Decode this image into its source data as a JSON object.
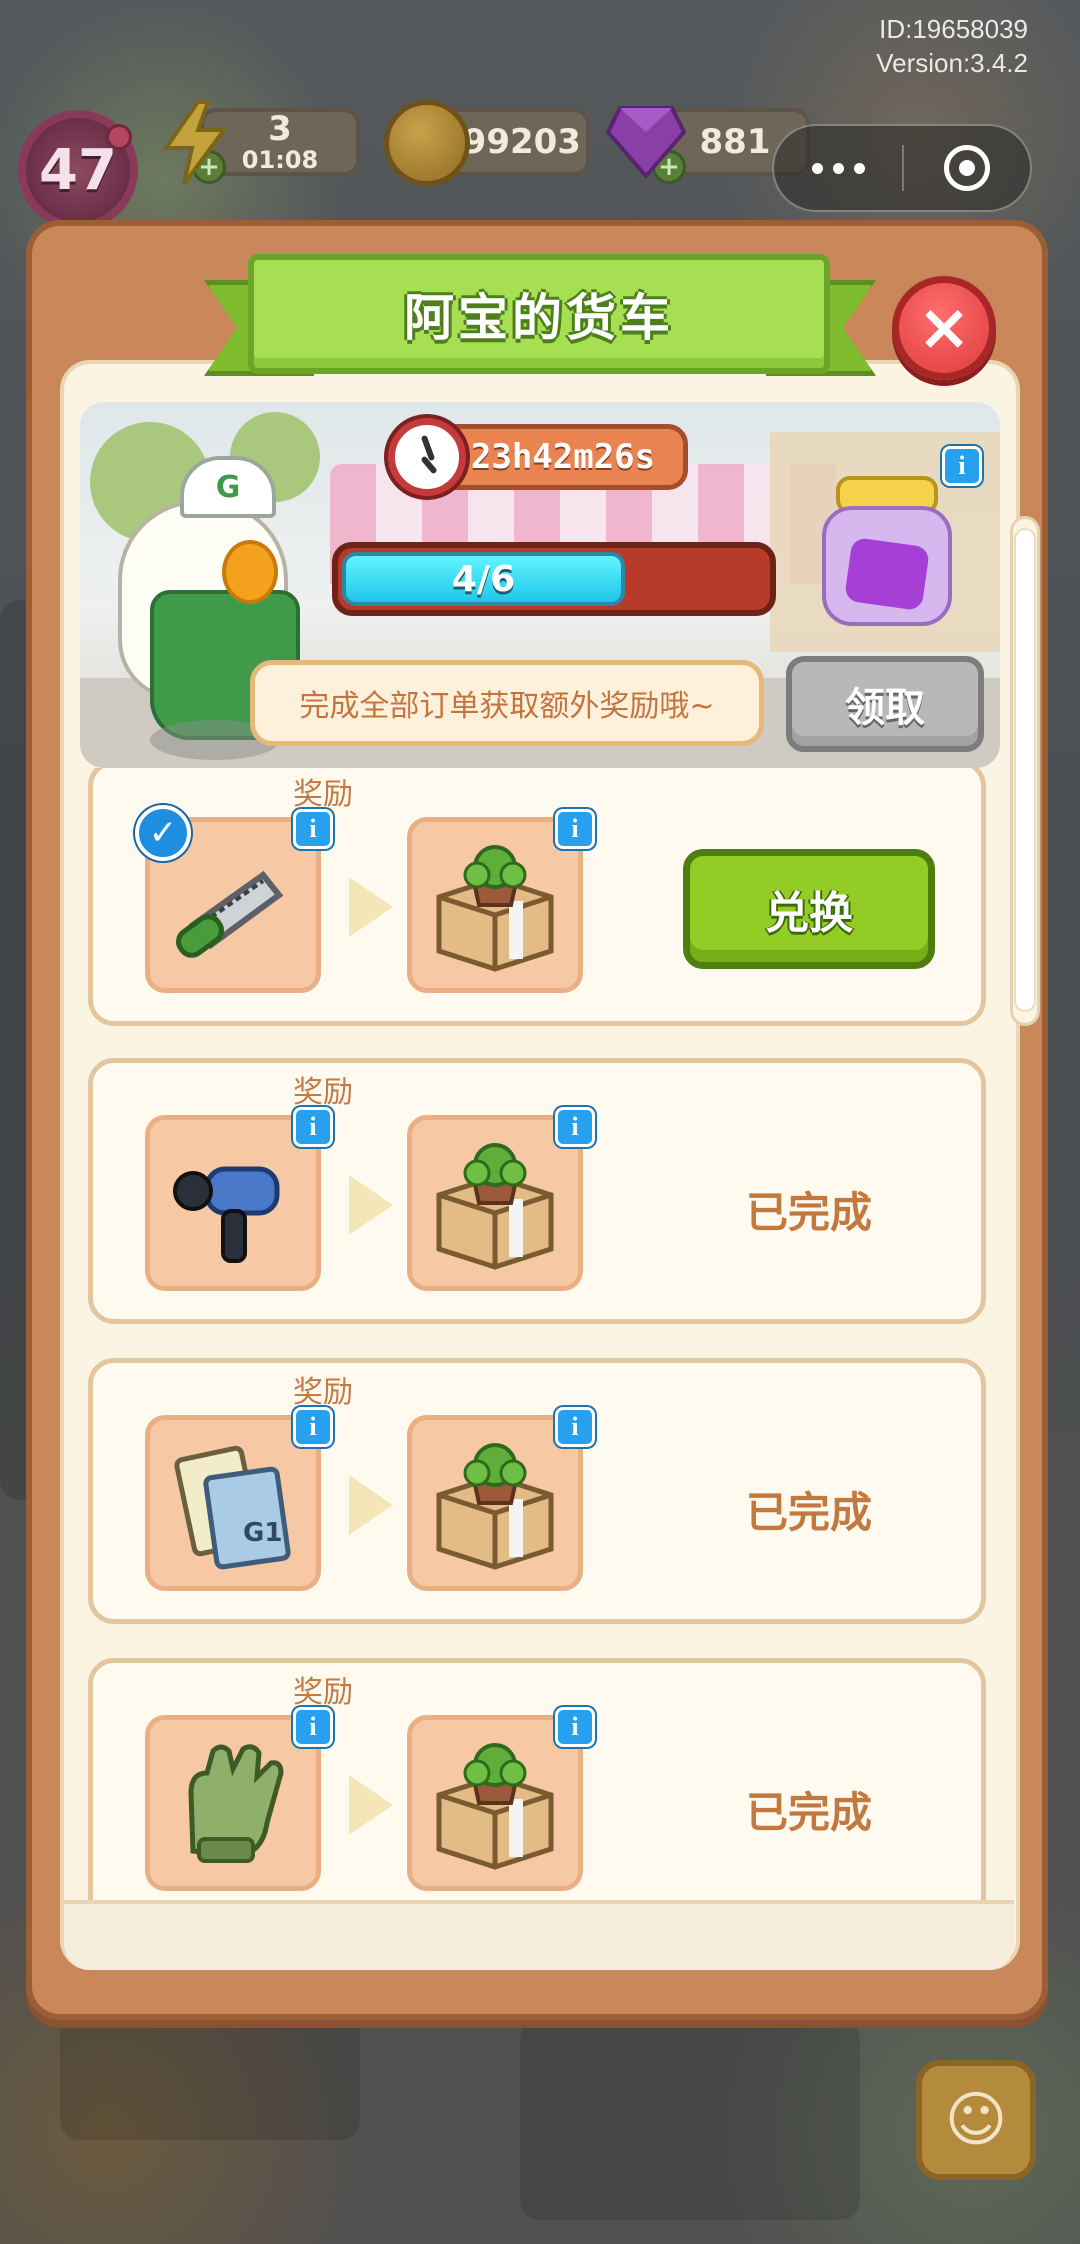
{
  "hud": {
    "level": "47",
    "energy": "3",
    "energy_timer": "01:08",
    "coins": "199203",
    "gems": "881",
    "id_text": "ID:19658039",
    "version_text": "Version:3.4.2"
  },
  "panel": {
    "title": "阿宝的货车",
    "close_icon": "×",
    "timer": "23h42m26s",
    "progress": {
      "label": "4/6",
      "value": 4,
      "max": 6
    },
    "hint": "完成全部订单获取额外奖励哦~",
    "claim_label": "领取",
    "info_icon": "i"
  },
  "orders": [
    {
      "label": "奖励",
      "item": "hacksaw",
      "reward": "potted-plant-box",
      "checked": true,
      "action": "兑换"
    },
    {
      "label": "奖励",
      "item": "massage-gun",
      "reward": "potted-plant-box",
      "checked": false,
      "status": "已完成"
    },
    {
      "label": "奖励",
      "item": "notebook-magazine",
      "reward": "potted-plant-box",
      "checked": false,
      "status": "已完成"
    },
    {
      "label": "奖励",
      "item": "work-glove",
      "reward": "potted-plant-box",
      "checked": false,
      "status": "已完成"
    }
  ],
  "colors": {
    "panel": "#c9875a",
    "ribbon": "#a6df52",
    "exchange_button": "#93cc25",
    "progress_fill": "#1fc7e8",
    "close_button": "#dd3b3b",
    "info_badge": "#28a0f0"
  }
}
